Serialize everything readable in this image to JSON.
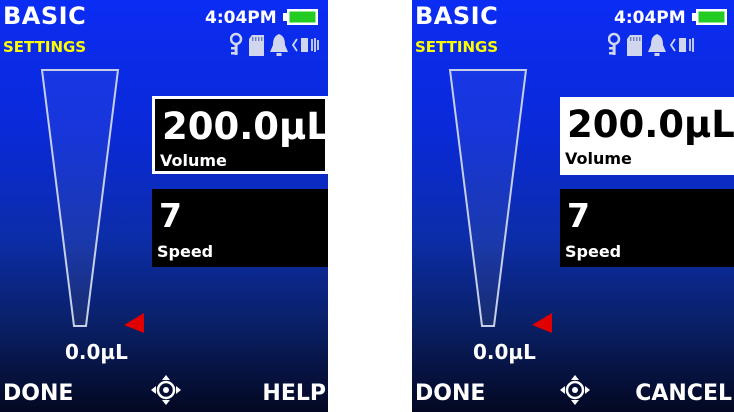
{
  "screens": [
    {
      "title": "BASIC",
      "subtitle": "SETTINGS",
      "time": "4:04PM",
      "volume": {
        "value": "200.0µL",
        "label": "Volume"
      },
      "speed": {
        "value": "7",
        "label": "Speed"
      },
      "tip_min_label": "0.0µL",
      "footer_left": "DONE",
      "footer_right": "HELP",
      "volume_highlighted": false
    },
    {
      "title": "BASIC",
      "subtitle": "SETTINGS",
      "time": "4:04PM",
      "volume": {
        "value": "200.0µL",
        "label": "Volume"
      },
      "speed": {
        "value": "7",
        "label": "Speed"
      },
      "tip_min_label": "0.0µL",
      "footer_left": "DONE",
      "footer_right": "CANCEL",
      "volume_highlighted": true
    }
  ],
  "icons": {
    "battery": "battery-icon",
    "key": "key-icon",
    "sd_card": "sd-card-icon",
    "bell": "bell-icon",
    "vibrate": "vibrate-icon",
    "navigation": "joystick-icon",
    "marker": "red-triangle-marker"
  },
  "colors": {
    "background_top": "#0b2cf3",
    "background_bottom": "#030822",
    "subtitle": "#ffff00",
    "battery": "#22cc22",
    "marker": "#e00000",
    "box": "#000000",
    "box_selected": "#ffffff"
  }
}
